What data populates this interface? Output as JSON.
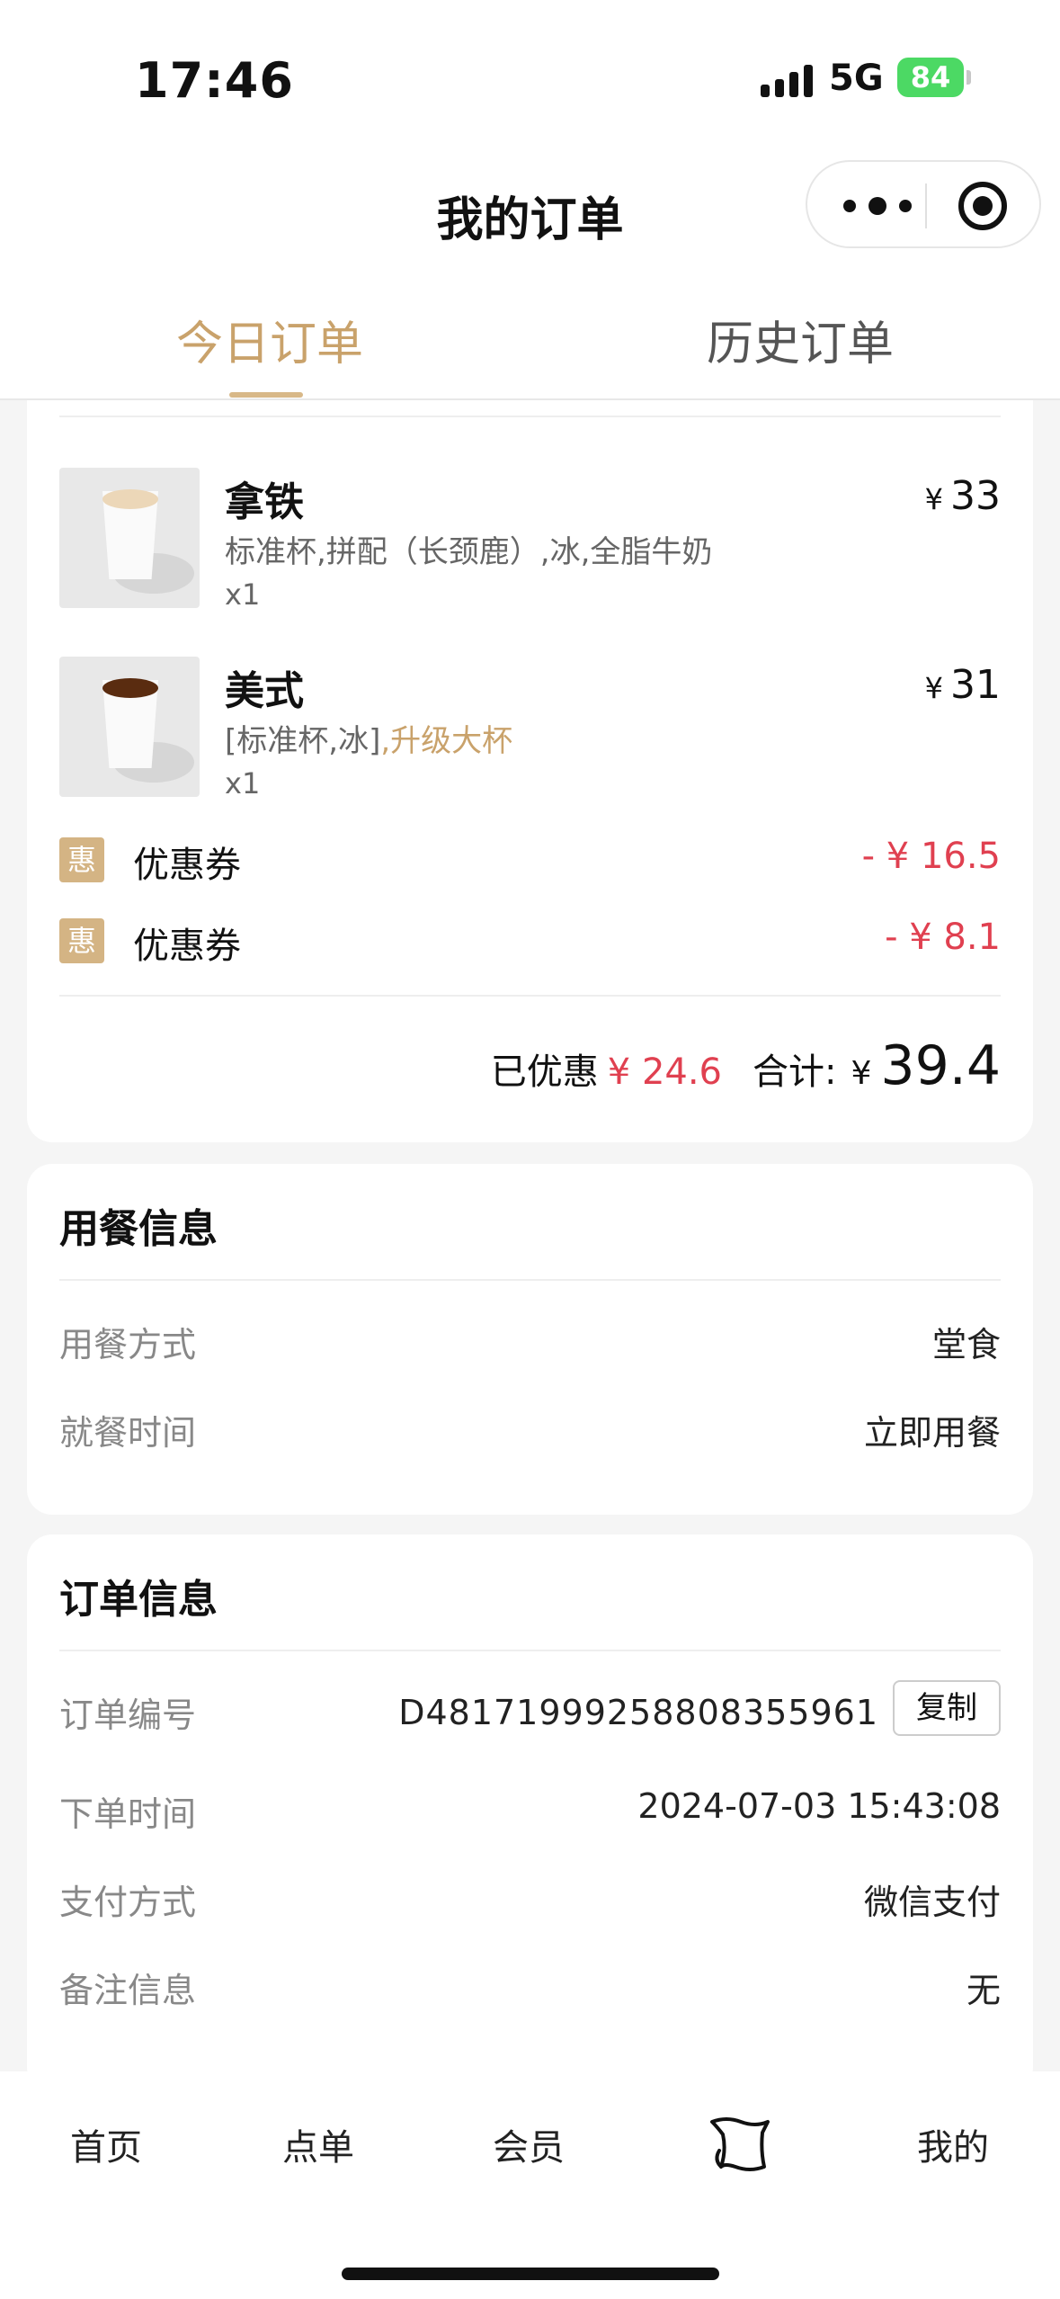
{
  "status_bar": {
    "time": "17:46",
    "network": "5G",
    "battery": "84"
  },
  "nav": {
    "title": "我的订单"
  },
  "tabs": [
    {
      "label": "今日订单",
      "active": true
    },
    {
      "label": "历史订单",
      "active": false
    }
  ],
  "order": {
    "products": [
      {
        "name": "拿铁",
        "spec": "标准杯,拼配（长颈鹿）,冰,全脂牛奶",
        "spec_highlight": "",
        "qty": "x1",
        "currency": "¥",
        "price": "33"
      },
      {
        "name": "美式",
        "spec": "[标准杯,冰]",
        "spec_highlight": ",升级大杯",
        "qty": "x1",
        "currency": "¥",
        "price": "31"
      }
    ],
    "coupons": [
      {
        "badge": "惠",
        "label": "优惠券",
        "value": "- ¥ 16.5"
      },
      {
        "badge": "惠",
        "label": "优惠券",
        "value": "- ¥ 8.1"
      }
    ],
    "discount_label": "已优惠",
    "discount_value": "¥ 24.6",
    "total_label": "合计:",
    "total_currency": "¥",
    "total_value": "39.4"
  },
  "dining": {
    "title": "用餐信息",
    "rows": [
      {
        "key": "用餐方式",
        "value": "堂食"
      },
      {
        "key": "就餐时间",
        "value": "立即用餐"
      }
    ]
  },
  "order_info": {
    "title": "订单信息",
    "rows": [
      {
        "key": "订单编号",
        "value": "D48171999258808355961"
      },
      {
        "key": "下单时间",
        "value": "2024-07-03 15:43:08"
      },
      {
        "key": "支付方式",
        "value": "微信支付"
      },
      {
        "key": "备注信息",
        "value": "无"
      }
    ],
    "copy_label": "复制"
  },
  "bottom_nav": [
    {
      "label": "首页"
    },
    {
      "label": "点单"
    },
    {
      "label": "会员"
    },
    {
      "icon": "scroll-icon"
    },
    {
      "label": "我的"
    }
  ],
  "colors": {
    "accent": "#c9a26b",
    "discount": "#e04050",
    "battery": "#4cd964"
  }
}
